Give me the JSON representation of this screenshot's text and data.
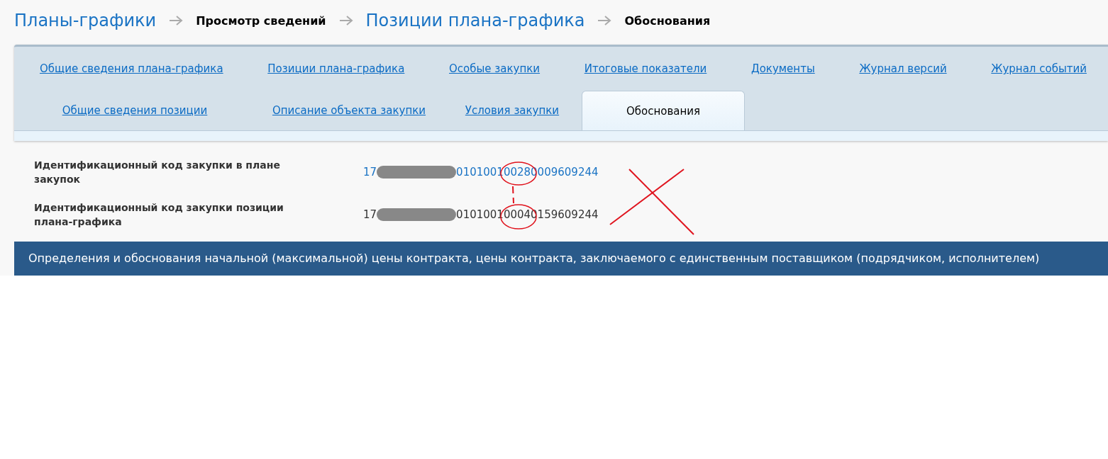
{
  "breadcrumbs": [
    {
      "label": "Планы-графики",
      "kind": "link"
    },
    {
      "label": "Просмотр сведений",
      "kind": "current"
    },
    {
      "label": "Позиции плана-графика",
      "kind": "link"
    },
    {
      "label": "Обоснования",
      "kind": "current"
    }
  ],
  "tab_rows": [
    {
      "tabs": [
        {
          "label": "Общие сведения плана-графика",
          "selected": false
        },
        {
          "label": "Позиции плана-графика",
          "selected": false
        },
        {
          "label": "Особые закупки",
          "selected": false
        },
        {
          "label": "Итоговые показатели",
          "selected": false
        },
        {
          "label": "Документы",
          "selected": false
        },
        {
          "label": "Журнал версий",
          "selected": false
        },
        {
          "label": "Журнал событий",
          "selected": false
        }
      ]
    },
    {
      "tabs": [
        {
          "label": "Общие сведения позиции",
          "selected": false
        },
        {
          "label": "Описание объекта закупки",
          "selected": false
        },
        {
          "label": "Условия закупки",
          "selected": false
        },
        {
          "label": "Обоснования",
          "selected": true
        }
      ]
    }
  ],
  "fields": [
    {
      "label": "Идентификационный код закупки в плане закупок",
      "value_start": "17",
      "value_end": "010100100280009609244",
      "kind": "link"
    },
    {
      "label": "Идентификационный код закупки позиции плана-графика",
      "value_start": "17",
      "value_end": "010100100040159609244",
      "kind": "text"
    }
  ],
  "section_header": "Определения и обоснования начальной (максимальной) цены контракта, цены контракта, заключаемого с единственным поставщиком (подрядчиком, исполнителем)"
}
